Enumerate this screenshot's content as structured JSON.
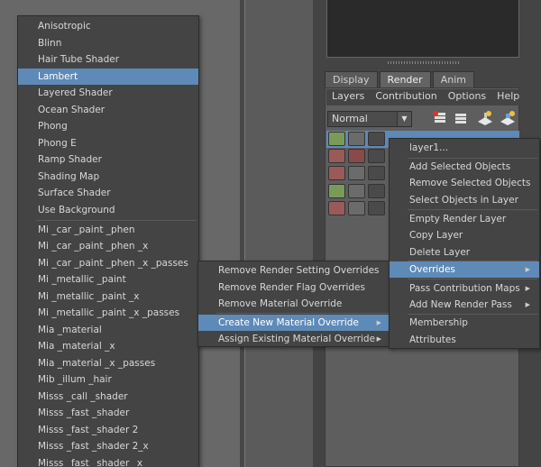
{
  "tabs": [
    "Display",
    "Render",
    "Anim"
  ],
  "menubar": [
    "Layers",
    "Contribution",
    "Options",
    "Help"
  ],
  "blend_mode": "Normal",
  "shader_menu": [
    "Anisotropic",
    "Blinn",
    "Hair Tube Shader",
    "Lambert",
    "Layered Shader",
    "Ocean Shader",
    "Phong",
    "Phong E",
    "Ramp Shader",
    "Shading Map",
    "Surface Shader",
    "Use Background",
    "Mi _car _paint _phen",
    "Mi _car _paint _phen _x",
    "Mi _car _paint _phen _x _passes",
    "Mi _metallic _paint",
    "Mi _metallic _paint _x",
    "Mi _metallic _paint _x _passes",
    "Mia _material",
    "Mia _material _x",
    "Mia _material _x _passes",
    "Mib _illum _hair",
    "Misss _call _shader",
    "Misss _fast _shader",
    "Misss _fast _shader 2",
    "Misss _fast _shader 2_x",
    "Misss _fast _shader _x"
  ],
  "shader_selected": "Lambert",
  "overrides_menu": [
    "Remove Render Setting Overrides",
    "Remove Render Flag Overrides",
    "Remove Material Override",
    "Create New Material Override",
    "Assign Existing Material Override"
  ],
  "overrides_selected": "Create New Material Override",
  "layer_menu": [
    "layer1...",
    "Add Selected Objects",
    "Remove Selected Objects",
    "Select Objects in Layer",
    "Empty Render Layer",
    "Copy Layer",
    "Delete Layer",
    "Overrides",
    "Pass Contribution Maps",
    "Add New Render Pass",
    "Membership",
    "Attributes"
  ],
  "layer_selected": "Overrides",
  "icons": [
    "render-layer-icon",
    "render-layer-copy-icon",
    "add-light-icon",
    "add-object-icon",
    "submenu-arrow-icon",
    "dropdown-arrow-icon"
  ]
}
